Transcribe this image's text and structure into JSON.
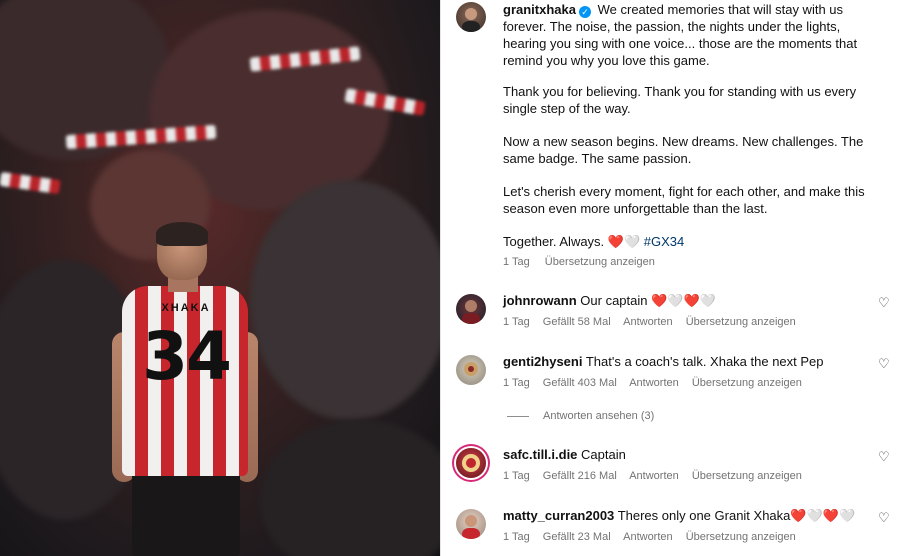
{
  "post": {
    "author": "granitxhaka",
    "verified_icon": "verified-badge-icon",
    "caption_lines": [
      "We created memories that will stay with us forever. The noise, the passion, the nights under the lights, hearing you sing with one voice... those are the moments that remind you why you love this game.",
      "Thank you for believing. Thank you for standing with us every single step of the way.",
      "Now a new season begins. New dreams. New challenges. The same badge. The same passion.",
      "Let's cherish every moment, fight for each other, and make this season even more unforgettable than the last."
    ],
    "closing_text": "Together. Always.",
    "closing_emoji": "❤️🤍",
    "hashtag": "#GX34",
    "time": "1 Tag",
    "translate_label": "Übersetzung anzeigen"
  },
  "photo": {
    "player_name": "XHAKA",
    "player_number": "34"
  },
  "comments": [
    {
      "username": "johnrowann",
      "text": "Our captain",
      "emoji": "❤️🤍❤️🤍",
      "time": "1 Tag",
      "likes": "Gefällt 58 Mal",
      "reply": "Antworten",
      "translate": "Übersetzung anzeigen"
    },
    {
      "username": "genti2hyseni",
      "text": "That's a coach's talk. Xhaka the next Pep",
      "emoji": "",
      "time": "1 Tag",
      "likes": "Gefällt 403 Mal",
      "reply": "Antworten",
      "translate": "Übersetzung anzeigen"
    },
    {
      "username": "safc.till.i.die",
      "text": "Captain",
      "emoji": "",
      "time": "1 Tag",
      "likes": "Gefällt 216 Mal",
      "reply": "Antworten",
      "translate": "Übersetzung anzeigen"
    },
    {
      "username": "matty_curran2003",
      "text": "Theres only one Granit Xhaka",
      "emoji": "❤️🤍❤️🤍",
      "time": "1 Tag",
      "likes": "Gefällt 23 Mal",
      "reply": "Antworten",
      "translate": "Übersetzung anzeigen"
    }
  ],
  "view_replies": "Antworten ansehen (3)",
  "colors": {
    "accent": "#0095f6",
    "heart": "#ff3040",
    "muted": "#737373",
    "shirt_red": "#c8262d"
  }
}
